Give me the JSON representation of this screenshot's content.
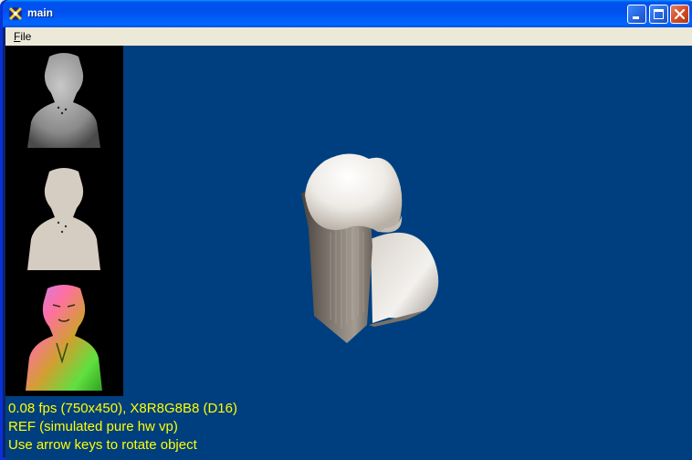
{
  "window": {
    "title": "main"
  },
  "menu": {
    "items": [
      {
        "label_underlined": "F",
        "label_rest": "ile"
      }
    ]
  },
  "titlebar_buttons": [
    "minimize-icon",
    "maximize-icon",
    "close-icon"
  ],
  "sidebar": {
    "thumbnails": [
      {
        "name": "grayscale-bust-thumbnail"
      },
      {
        "name": "flat-bust-thumbnail"
      },
      {
        "name": "normal-map-bust-thumbnail"
      }
    ]
  },
  "status": {
    "lines": [
      "0.08 fps (750x450), X8R8G8B8 (D16)",
      "REF (simulated pure hw vp)",
      "Use arrow keys to rotate object"
    ]
  },
  "colors": {
    "viewport_background": "#003f7f",
    "status_text": "#ffff00",
    "sidebar_background": "#000000"
  }
}
